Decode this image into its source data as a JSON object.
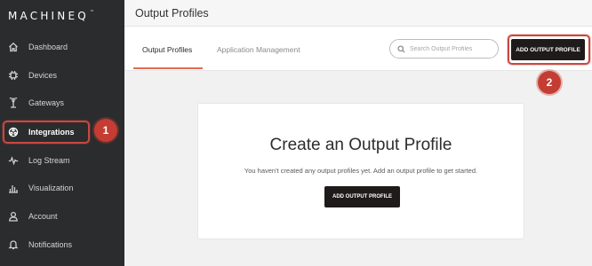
{
  "brand": {
    "logo_text": "MACHINEQ",
    "trademark": "™"
  },
  "sidebar": {
    "items": [
      {
        "label": "Dashboard",
        "icon": "home-icon"
      },
      {
        "label": "Devices",
        "icon": "chip-icon"
      },
      {
        "label": "Gateways",
        "icon": "gateway-icon"
      },
      {
        "label": "Integrations",
        "icon": "integrations-icon",
        "active": true
      },
      {
        "label": "Log Stream",
        "icon": "pulse-icon"
      },
      {
        "label": "Visualization",
        "icon": "bar-chart-icon"
      },
      {
        "label": "Account",
        "icon": "user-icon"
      },
      {
        "label": "Notifications",
        "icon": "bell-icon"
      }
    ]
  },
  "header": {
    "title": "Output Profiles"
  },
  "tabs": [
    {
      "label": "Output Profiles",
      "active": true
    },
    {
      "label": "Application Management",
      "active": false
    }
  ],
  "search": {
    "placeholder": "Search Output Profiles",
    "value": ""
  },
  "toolbar": {
    "add_label": "ADD OUTPUT PROFILE"
  },
  "empty_state": {
    "title": "Create an Output Profile",
    "description": "You haven't created any output profiles yet. Add an output profile to get started.",
    "button_label": "ADD OUTPUT PROFILE"
  },
  "annotations": [
    {
      "number": "1"
    },
    {
      "number": "2"
    }
  ],
  "colors": {
    "sidebar_bg": "#2b2c2e",
    "accent": "#e06a54",
    "highlight": "#c9483f",
    "button_dark": "#1e1b1a"
  }
}
